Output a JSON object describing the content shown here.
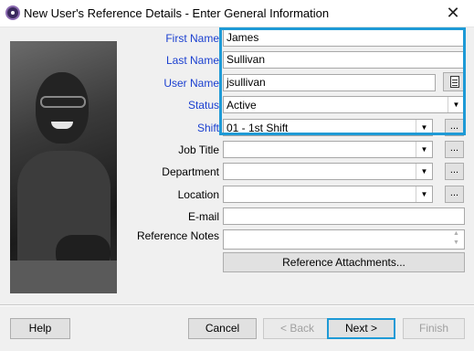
{
  "window": {
    "title": "New User's Reference Details - Enter General Information",
    "close_glyph": "✕"
  },
  "form": {
    "first_name": {
      "label": "First Name",
      "value": "James"
    },
    "last_name": {
      "label": "Last Name",
      "value": "Sullivan"
    },
    "user_name": {
      "label": "User Name",
      "value": "jsullivan"
    },
    "status": {
      "label": "Status",
      "value": "Active"
    },
    "shift": {
      "label": "Shift",
      "value": "01 - 1st Shift"
    },
    "job_title": {
      "label": "Job Title",
      "value": ""
    },
    "department": {
      "label": "Department",
      "value": ""
    },
    "location": {
      "label": "Location",
      "value": ""
    },
    "email": {
      "label": "E-mail",
      "value": ""
    },
    "reference_notes": {
      "label": "Reference Notes",
      "value": ""
    },
    "ellipsis": "..."
  },
  "buttons": {
    "reference_attachments": "Reference Attachments...",
    "help": "Help",
    "cancel": "Cancel",
    "back": "< Back",
    "next": "Next >",
    "finish": "Finish"
  },
  "colors": {
    "required_label": "#1a3fd0",
    "focus_highlight": "#1e9ad6",
    "dialog_bg": "#f0f0f0"
  },
  "icons": {
    "app": "app-icon",
    "close": "close-icon",
    "dropdown": "chevron-down-icon",
    "lookup": "document-icon"
  }
}
